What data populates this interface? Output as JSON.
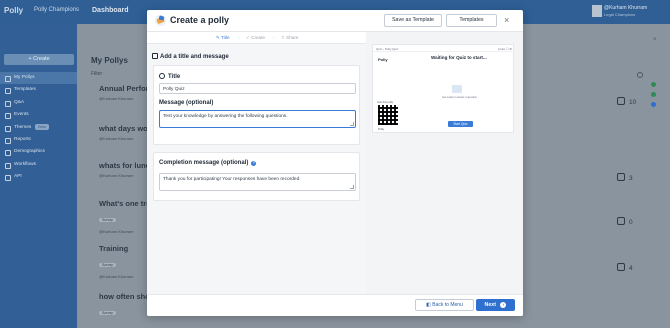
{
  "app": {
    "logo": "Polly",
    "workspace": "Polly Champions",
    "page": "Dashboard",
    "user_name": "@Kurham Khurram",
    "user_role": "Legal Champions",
    "create_label": "+ Create",
    "nav": [
      {
        "label": "My Pollys",
        "active": true
      },
      {
        "label": "Templates"
      },
      {
        "label": "Q&A"
      },
      {
        "label": "Events"
      },
      {
        "label": "Themes",
        "badge": "Beta"
      },
      {
        "label": "Reports"
      },
      {
        "label": "Demographics"
      },
      {
        "label": "Workflows"
      },
      {
        "label": "API"
      }
    ],
    "page_title": "My Pollys",
    "filter_label": "Filter",
    "cards": [
      {
        "title": "Annual Perfor",
        "sub": "@Kurham Khurram",
        "count": "10"
      },
      {
        "title": "what days wo",
        "sub": "@Kurham Khurram"
      },
      {
        "title": "whats for lunc",
        "sub": "@Kurham Khurram",
        "count": "3"
      },
      {
        "title": "What's one tre",
        "tag": "Survey",
        "sub": "@Kurham Khurram",
        "count": "0"
      },
      {
        "title": "Training",
        "tag": "Survey",
        "sub": "@Kurham Khurram",
        "count": "4"
      },
      {
        "title": "how often sho",
        "tag": "Survey",
        "sub": ""
      }
    ]
  },
  "modal": {
    "title": "Create a polly",
    "save_template": "Save as Template",
    "templates": "Templates",
    "close": "×",
    "steps": [
      {
        "label": "Title",
        "active": true
      },
      {
        "label": "Create"
      },
      {
        "label": "Share"
      }
    ],
    "section_title": "Add a title and message",
    "title_label": "Title",
    "title_value": "Polly Quiz",
    "message_label": "Message (optional)",
    "message_value": "Test your knowledge by answering the following questions.",
    "completion_label": "Completion message (optional)",
    "completion_value": "Thank you for participating! Your responses have been recorded.",
    "help": "?",
    "preview": {
      "crumb": "Quiz › Polly Quiz",
      "right": "Links  ☐  ⚙",
      "logo": "Polly",
      "waiting": "Waiting for Quiz to start...",
      "sub": "Get ready to answer a question",
      "join": "Join this polly",
      "brand": "Polly",
      "start": "Start Quiz"
    },
    "back_label": "Back to Menu",
    "next_label": "Next",
    "next_arrow": "›"
  },
  "colors": {
    "primary": "#2f6fcf",
    "sidebar": "#325f95"
  }
}
